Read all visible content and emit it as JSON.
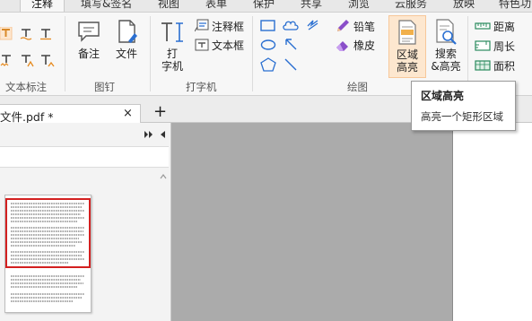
{
  "menu": {
    "tabs": [
      {
        "label": "注释",
        "active": true
      },
      {
        "label": "填写&签名"
      },
      {
        "label": "视图"
      },
      {
        "label": "表单"
      },
      {
        "label": "保护"
      },
      {
        "label": "共享"
      },
      {
        "label": "浏览"
      },
      {
        "label": "云服务"
      },
      {
        "label": "放映"
      },
      {
        "label": "特色功"
      }
    ]
  },
  "ribbon": {
    "groups": {
      "text_markup": "文本标注",
      "pin": "图钉",
      "typewriter": "打字机",
      "drawing": "绘图"
    },
    "buttons": {
      "note": "备注",
      "file": "文件",
      "typewriter_line1": "打",
      "typewriter_line2": "字机",
      "callout": "注释框",
      "textbox": "文本框",
      "pencil": "铅笔",
      "eraser": "橡皮",
      "area_highlight_line1": "区域",
      "area_highlight_line2": "高亮",
      "search_highlight_line1": "搜索",
      "search_highlight_line2": "&高亮",
      "distance": "距离",
      "perimeter": "周长",
      "area": "面积"
    },
    "accent_color": "#f7c79a",
    "highlight_bg": "#fde7cf"
  },
  "tooltip": {
    "title": "区域高亮",
    "body": "高亮一个矩形区域"
  },
  "doc_tabs": {
    "title": "文件.pdf *",
    "close": "×",
    "new_tab": "+"
  },
  "thumbnails": {
    "selection_color": "#d32020"
  }
}
